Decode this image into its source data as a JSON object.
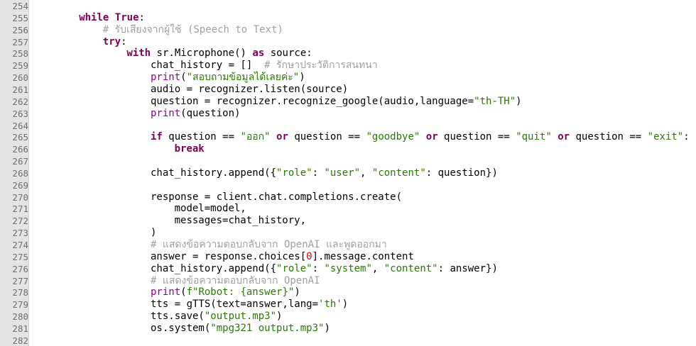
{
  "editor": {
    "lines": [
      {
        "n": "254",
        "indent": 0,
        "tokens": []
      },
      {
        "n": "255",
        "indent": 2,
        "tokens": [
          {
            "t": "while",
            "c": "kw"
          },
          {
            "t": " "
          },
          {
            "t": "True",
            "c": "kw"
          },
          {
            "t": ":"
          }
        ]
      },
      {
        "n": "256",
        "indent": 3,
        "tokens": [
          {
            "t": "# รับเสียงจากผู้ใช้ (Speech to Text)",
            "c": "cmt"
          }
        ]
      },
      {
        "n": "257",
        "indent": 3,
        "tokens": [
          {
            "t": "try",
            "c": "kw"
          },
          {
            "t": ":"
          }
        ]
      },
      {
        "n": "258",
        "indent": 4,
        "tokens": [
          {
            "t": "with",
            "c": "kw"
          },
          {
            "t": " sr.Microphone() "
          },
          {
            "t": "as",
            "c": "kw"
          },
          {
            "t": " source:"
          }
        ]
      },
      {
        "n": "259",
        "indent": 5,
        "tokens": [
          {
            "t": "chat_history = []  "
          },
          {
            "t": "# รักษาประวัติการสนทนา",
            "c": "cmt"
          }
        ]
      },
      {
        "n": "260",
        "indent": 5,
        "tokens": [
          {
            "t": "print",
            "c": "bi"
          },
          {
            "t": "("
          },
          {
            "t": "\"สอบถามข้อมูลได้เลยค่ะ\"",
            "c": "str"
          },
          {
            "t": ")"
          }
        ]
      },
      {
        "n": "261",
        "indent": 5,
        "tokens": [
          {
            "t": "audio = recognizer.listen(source)"
          }
        ]
      },
      {
        "n": "262",
        "indent": 5,
        "tokens": [
          {
            "t": "question = recognizer.recognize_google(audio,language="
          },
          {
            "t": "\"th-TH\"",
            "c": "str"
          },
          {
            "t": ")"
          }
        ]
      },
      {
        "n": "263",
        "indent": 5,
        "tokens": [
          {
            "t": "print",
            "c": "bi"
          },
          {
            "t": "(question)"
          }
        ]
      },
      {
        "n": "264",
        "indent": 0,
        "tokens": []
      },
      {
        "n": "265",
        "indent": 5,
        "tokens": [
          {
            "t": "if",
            "c": "kw"
          },
          {
            "t": " question == "
          },
          {
            "t": "\"ออก\"",
            "c": "str"
          },
          {
            "t": " "
          },
          {
            "t": "or",
            "c": "kw"
          },
          {
            "t": " question == "
          },
          {
            "t": "\"goodbye\"",
            "c": "str"
          },
          {
            "t": " "
          },
          {
            "t": "or",
            "c": "kw"
          },
          {
            "t": " question == "
          },
          {
            "t": "\"quit\"",
            "c": "str"
          },
          {
            "t": " "
          },
          {
            "t": "or",
            "c": "kw"
          },
          {
            "t": " question == "
          },
          {
            "t": "\"exit\"",
            "c": "str"
          },
          {
            "t": ":"
          }
        ]
      },
      {
        "n": "266",
        "indent": 6,
        "tokens": [
          {
            "t": "break",
            "c": "kw"
          }
        ]
      },
      {
        "n": "267",
        "indent": 0,
        "tokens": []
      },
      {
        "n": "268",
        "indent": 5,
        "tokens": [
          {
            "t": "chat_history.append({"
          },
          {
            "t": "\"role\"",
            "c": "str"
          },
          {
            "t": ": "
          },
          {
            "t": "\"user\"",
            "c": "str"
          },
          {
            "t": ", "
          },
          {
            "t": "\"content\"",
            "c": "str"
          },
          {
            "t": ": question})"
          }
        ]
      },
      {
        "n": "269",
        "indent": 0,
        "tokens": []
      },
      {
        "n": "270",
        "indent": 5,
        "tokens": [
          {
            "t": "response = client.chat.completions.create("
          }
        ]
      },
      {
        "n": "271",
        "indent": 6,
        "tokens": [
          {
            "t": "model=model,"
          }
        ]
      },
      {
        "n": "272",
        "indent": 6,
        "tokens": [
          {
            "t": "messages=chat_history,"
          }
        ]
      },
      {
        "n": "273",
        "indent": 5,
        "tokens": [
          {
            "t": ")"
          }
        ]
      },
      {
        "n": "274",
        "indent": 5,
        "tokens": [
          {
            "t": "# แสดงข้อความตอบกลับจาก OpenAI และพูดออกมา",
            "c": "cmt"
          }
        ]
      },
      {
        "n": "275",
        "indent": 5,
        "tokens": [
          {
            "t": "answer = response.choices["
          },
          {
            "t": "0",
            "c": "num"
          },
          {
            "t": "].message.content"
          }
        ]
      },
      {
        "n": "276",
        "indent": 5,
        "tokens": [
          {
            "t": "chat_history.append({"
          },
          {
            "t": "\"role\"",
            "c": "str"
          },
          {
            "t": ": "
          },
          {
            "t": "\"system\"",
            "c": "str"
          },
          {
            "t": ", "
          },
          {
            "t": "\"content\"",
            "c": "str"
          },
          {
            "t": ": answer})"
          }
        ]
      },
      {
        "n": "277",
        "indent": 5,
        "tokens": [
          {
            "t": "# แสดงข้อความตอบกลับจาก OpenAI",
            "c": "cmt"
          }
        ]
      },
      {
        "n": "278",
        "indent": 5,
        "tokens": [
          {
            "t": "print",
            "c": "bi"
          },
          {
            "t": "("
          },
          {
            "t": "f\"Robot: {answer}\"",
            "c": "str"
          },
          {
            "t": ")"
          }
        ]
      },
      {
        "n": "279",
        "indent": 5,
        "tokens": [
          {
            "t": "tts = gTTS(text=answer,lang="
          },
          {
            "t": "'th'",
            "c": "str"
          },
          {
            "t": ")"
          }
        ]
      },
      {
        "n": "280",
        "indent": 5,
        "tokens": [
          {
            "t": "tts.save("
          },
          {
            "t": "\"output.mp3\"",
            "c": "str"
          },
          {
            "t": ")"
          }
        ]
      },
      {
        "n": "281",
        "indent": 5,
        "tokens": [
          {
            "t": "os.system("
          },
          {
            "t": "\"mpg321 output.mp3\"",
            "c": "str"
          },
          {
            "t": ")"
          }
        ]
      },
      {
        "n": "282",
        "indent": 0,
        "tokens": []
      }
    ]
  },
  "colors": {
    "keyword": "#7f0055",
    "builtin": "#900090",
    "string": "#2a7a00",
    "number": "#e00000",
    "comment": "#a0a0a0",
    "gutter": "#e4e4e4"
  }
}
